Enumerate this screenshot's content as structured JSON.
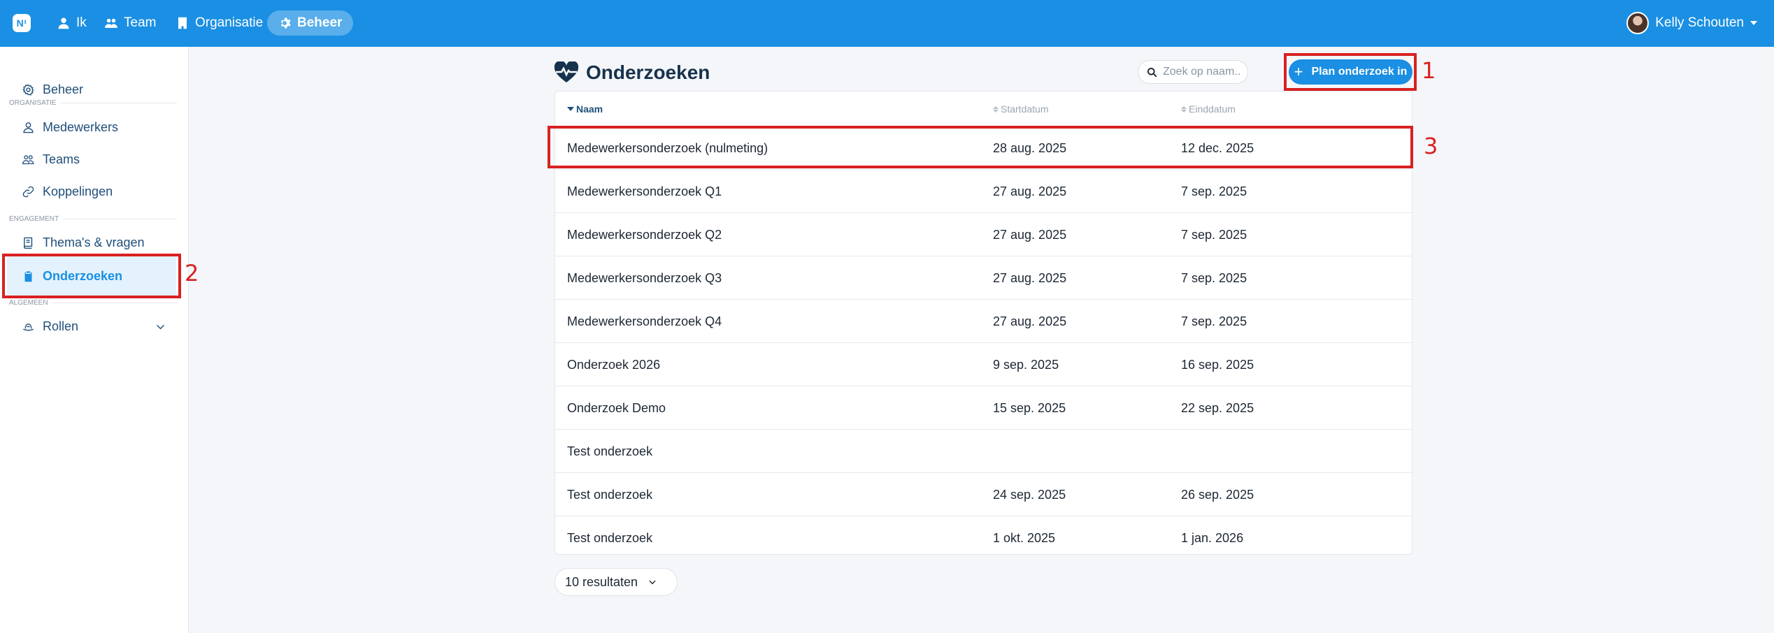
{
  "topbar": {
    "logo": "N¹",
    "nav": [
      {
        "label": "Ik",
        "icon": "user-icon"
      },
      {
        "label": "Team",
        "icon": "users-icon"
      },
      {
        "label": "Organisatie",
        "icon": "building-icon"
      },
      {
        "label": "Beheer",
        "icon": "gear-icon",
        "active": true
      }
    ],
    "user_name": "Kelly Schouten"
  },
  "sidebar": {
    "top_item": "Beheer",
    "sections": [
      {
        "label": "Organisatie",
        "items": [
          "Medewerkers",
          "Teams",
          "Koppelingen"
        ]
      },
      {
        "label": "Engagement",
        "items": [
          "Thema's & vragen",
          "Onderzoeken"
        ]
      },
      {
        "label": "Algemeen",
        "items": [
          "Rollen"
        ]
      }
    ],
    "active_item": "Onderzoeken"
  },
  "main": {
    "title": "Onderzoeken",
    "search_placeholder": "Zoek op naam...",
    "plan_button": "Plan onderzoek in",
    "columns": [
      "Naam",
      "Startdatum",
      "Einddatum"
    ],
    "sorted_column": "Naam",
    "rows": [
      {
        "name": "Medewerkersonderzoek (nulmeting)",
        "start": "28 aug. 2025",
        "end": "12 dec. 2025"
      },
      {
        "name": "Medewerkersonderzoek Q1",
        "start": "27 aug. 2025",
        "end": "7 sep. 2025"
      },
      {
        "name": "Medewerkersonderzoek Q2",
        "start": "27 aug. 2025",
        "end": "7 sep. 2025"
      },
      {
        "name": "Medewerkersonderzoek Q3",
        "start": "27 aug. 2025",
        "end": "7 sep. 2025"
      },
      {
        "name": "Medewerkersonderzoek Q4",
        "start": "27 aug. 2025",
        "end": "7 sep. 2025"
      },
      {
        "name": "Onderzoek 2026",
        "start": "9 sep. 2025",
        "end": "16 sep. 2025"
      },
      {
        "name": "Onderzoek Demo",
        "start": "15 sep. 2025",
        "end": "22 sep. 2025"
      },
      {
        "name": "Test onderzoek",
        "start": "",
        "end": ""
      },
      {
        "name": "Test onderzoek",
        "start": "24 sep. 2025",
        "end": "26 sep. 2025"
      },
      {
        "name": "Test onderzoek",
        "start": "1 okt. 2025",
        "end": "1 jan. 2026"
      }
    ],
    "results_label": "10 resultaten"
  },
  "annotations": [
    "1",
    "2",
    "3"
  ],
  "colors": {
    "primary": "#1a8fe3",
    "annotation": "#d92121",
    "sidebar_active_bg": "#e4f2fd"
  }
}
